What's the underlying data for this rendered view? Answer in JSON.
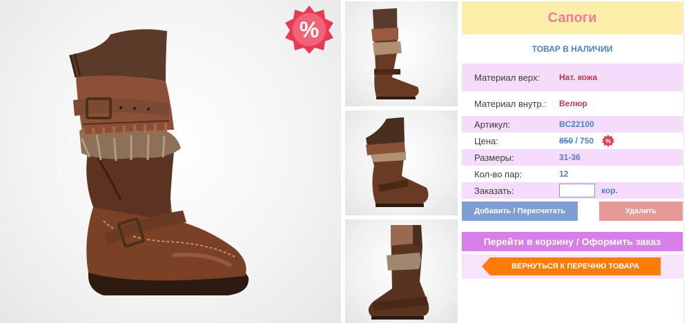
{
  "product": {
    "title": "Сапоги",
    "stock_status": "ТОВАР В НАЛИЧИИ",
    "sale_badge": "%",
    "details": [
      {
        "label": "Материал верх:",
        "value": "Нат. кожа"
      },
      {
        "label": "Материал внутр.:",
        "value": "Велюр"
      },
      {
        "label": "Артикул:",
        "value": "BC22100"
      },
      {
        "label": "Цена:",
        "old_price": "850",
        "separator": " / ",
        "new_price": "750",
        "badge": "%"
      },
      {
        "label": "Размеры:",
        "value": "31-36"
      },
      {
        "label": "Кол-во пар:",
        "value": "12"
      },
      {
        "label": "Заказать:",
        "unit": "кор.",
        "input_value": ""
      }
    ]
  },
  "actions": {
    "add_label": "Добавить / Пересчитать",
    "delete_label": "Удалить",
    "cart_label": "Перейти в корзину / Оформить заказ",
    "back_label": "ВЕРНУТЬСЯ К ПЕРЕЧНЮ ТОВАРА"
  },
  "images": {
    "main_icon": "boot-photo",
    "thumbnails": [
      "boot-front-photo",
      "boot-side-photo",
      "boot-inner-side-photo"
    ]
  },
  "colors": {
    "title_bg": "#fbeea9",
    "title_text": "#ec7da0",
    "row_pink": "#f5dcfb",
    "value_red": "#c7354b",
    "value_blue": "#4c7fc6",
    "add_button": "#7f9fd3",
    "delete_button": "#e59a98",
    "cart_button": "#d77ee8",
    "back_button": "#ff7c08"
  }
}
